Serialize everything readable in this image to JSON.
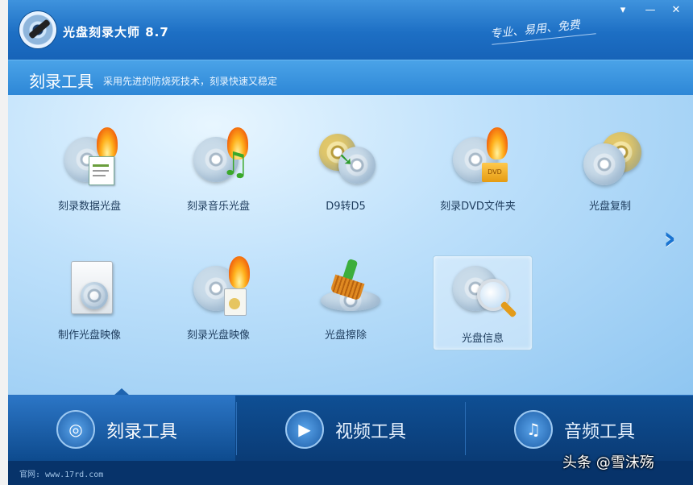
{
  "app": {
    "title": "光盘刻录大师 8.7",
    "slogan": "专业、易用、免费"
  },
  "window_controls": {
    "menu": "▾",
    "minimize": "—",
    "close": "✕"
  },
  "section": {
    "title": "刻录工具",
    "description": "采用先进的防烧死技术，刻录快速又稳定"
  },
  "tools": [
    {
      "label": "刻录数据光盘",
      "icon": "burn-data-disc-icon"
    },
    {
      "label": "刻录音乐光盘",
      "icon": "burn-music-disc-icon"
    },
    {
      "label": "D9转D5",
      "icon": "d9-to-d5-icon"
    },
    {
      "label": "刻录DVD文件夹",
      "icon": "burn-dvd-folder-icon"
    },
    {
      "label": "光盘复制",
      "icon": "disc-copy-icon"
    },
    {
      "label": "制作光盘映像",
      "icon": "make-disc-image-icon"
    },
    {
      "label": "刻录光盘映像",
      "icon": "burn-disc-image-icon"
    },
    {
      "label": "光盘擦除",
      "icon": "disc-erase-icon"
    },
    {
      "label": "光盘信息",
      "icon": "disc-info-icon",
      "selected": true
    }
  ],
  "dvd_badge": "DVD",
  "next_arrow": "›",
  "tabs": [
    {
      "label": "刻录工具",
      "icon": "disc-icon",
      "active": true
    },
    {
      "label": "视频工具",
      "icon": "film-icon"
    },
    {
      "label": "音频工具",
      "icon": "music-note-icon"
    }
  ],
  "footer": {
    "site": "官网: www.17rd.com"
  },
  "watermark": "头条 @雪沫殇",
  "colors": {
    "title_bar": "#1d6fc4",
    "content_bg": "#bfe1fb",
    "tab_bar": "#0a3b75",
    "accent_arrow": "#1a74d1"
  }
}
